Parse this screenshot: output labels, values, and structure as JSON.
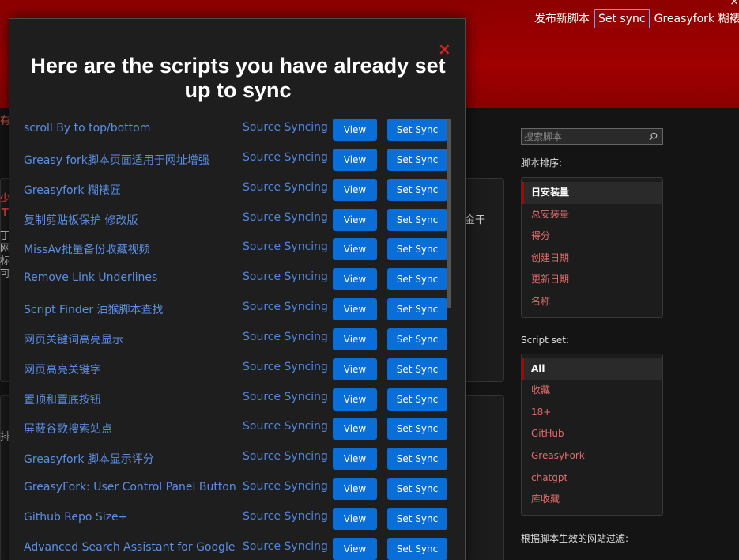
{
  "header": {
    "nav": [
      "发布新脚本",
      "Set sync",
      "Greasyfork 糊裱匠"
    ],
    "close_glyph": "×"
  },
  "background": {
    "left_text": "有",
    "fragments": [
      "少",
      "T",
      "丁",
      "网",
      "标",
      "可",
      "金干",
      "排"
    ]
  },
  "sidebar": {
    "search_placeholder": "搜索脚本",
    "sort_title": "脚本排序:",
    "sort_items": [
      "日安装量",
      "总安装量",
      "得分",
      "创建日期",
      "更新日期",
      "名称"
    ],
    "scriptset_title": "Script set:",
    "scriptset_items": [
      "All",
      "收藏",
      "18+",
      "GitHub",
      "GreasyFork",
      "chatgpt",
      "库收藏"
    ],
    "filter_title": "根据脚本生效的网站过滤:"
  },
  "modal": {
    "title": "Here are the scripts you have already set up to sync",
    "close_glyph": "×",
    "view_label": "View",
    "set_sync_label": "Set Sync",
    "status_label": "Source Syncing",
    "scripts": [
      "scroll By to top/bottom",
      "Greasy fork脚本页面适用于网址增强",
      "Greasyfork 糊裱匠",
      "复制剪贴板保护 修改版",
      "MissAv批量备份收藏视频",
      "Remove Link Underlines",
      "Script Finder 油猴脚本查找",
      "网页关键词高亮显示",
      "网页高亮关键字",
      "置顶和置底按钮",
      "屏蔽谷歌搜索站点",
      "Greasyfork 脚本显示评分",
      "GreasyFork: User Control Panel Button",
      "Github Repo Size+",
      "Advanced Search Assistant for Google"
    ]
  }
}
